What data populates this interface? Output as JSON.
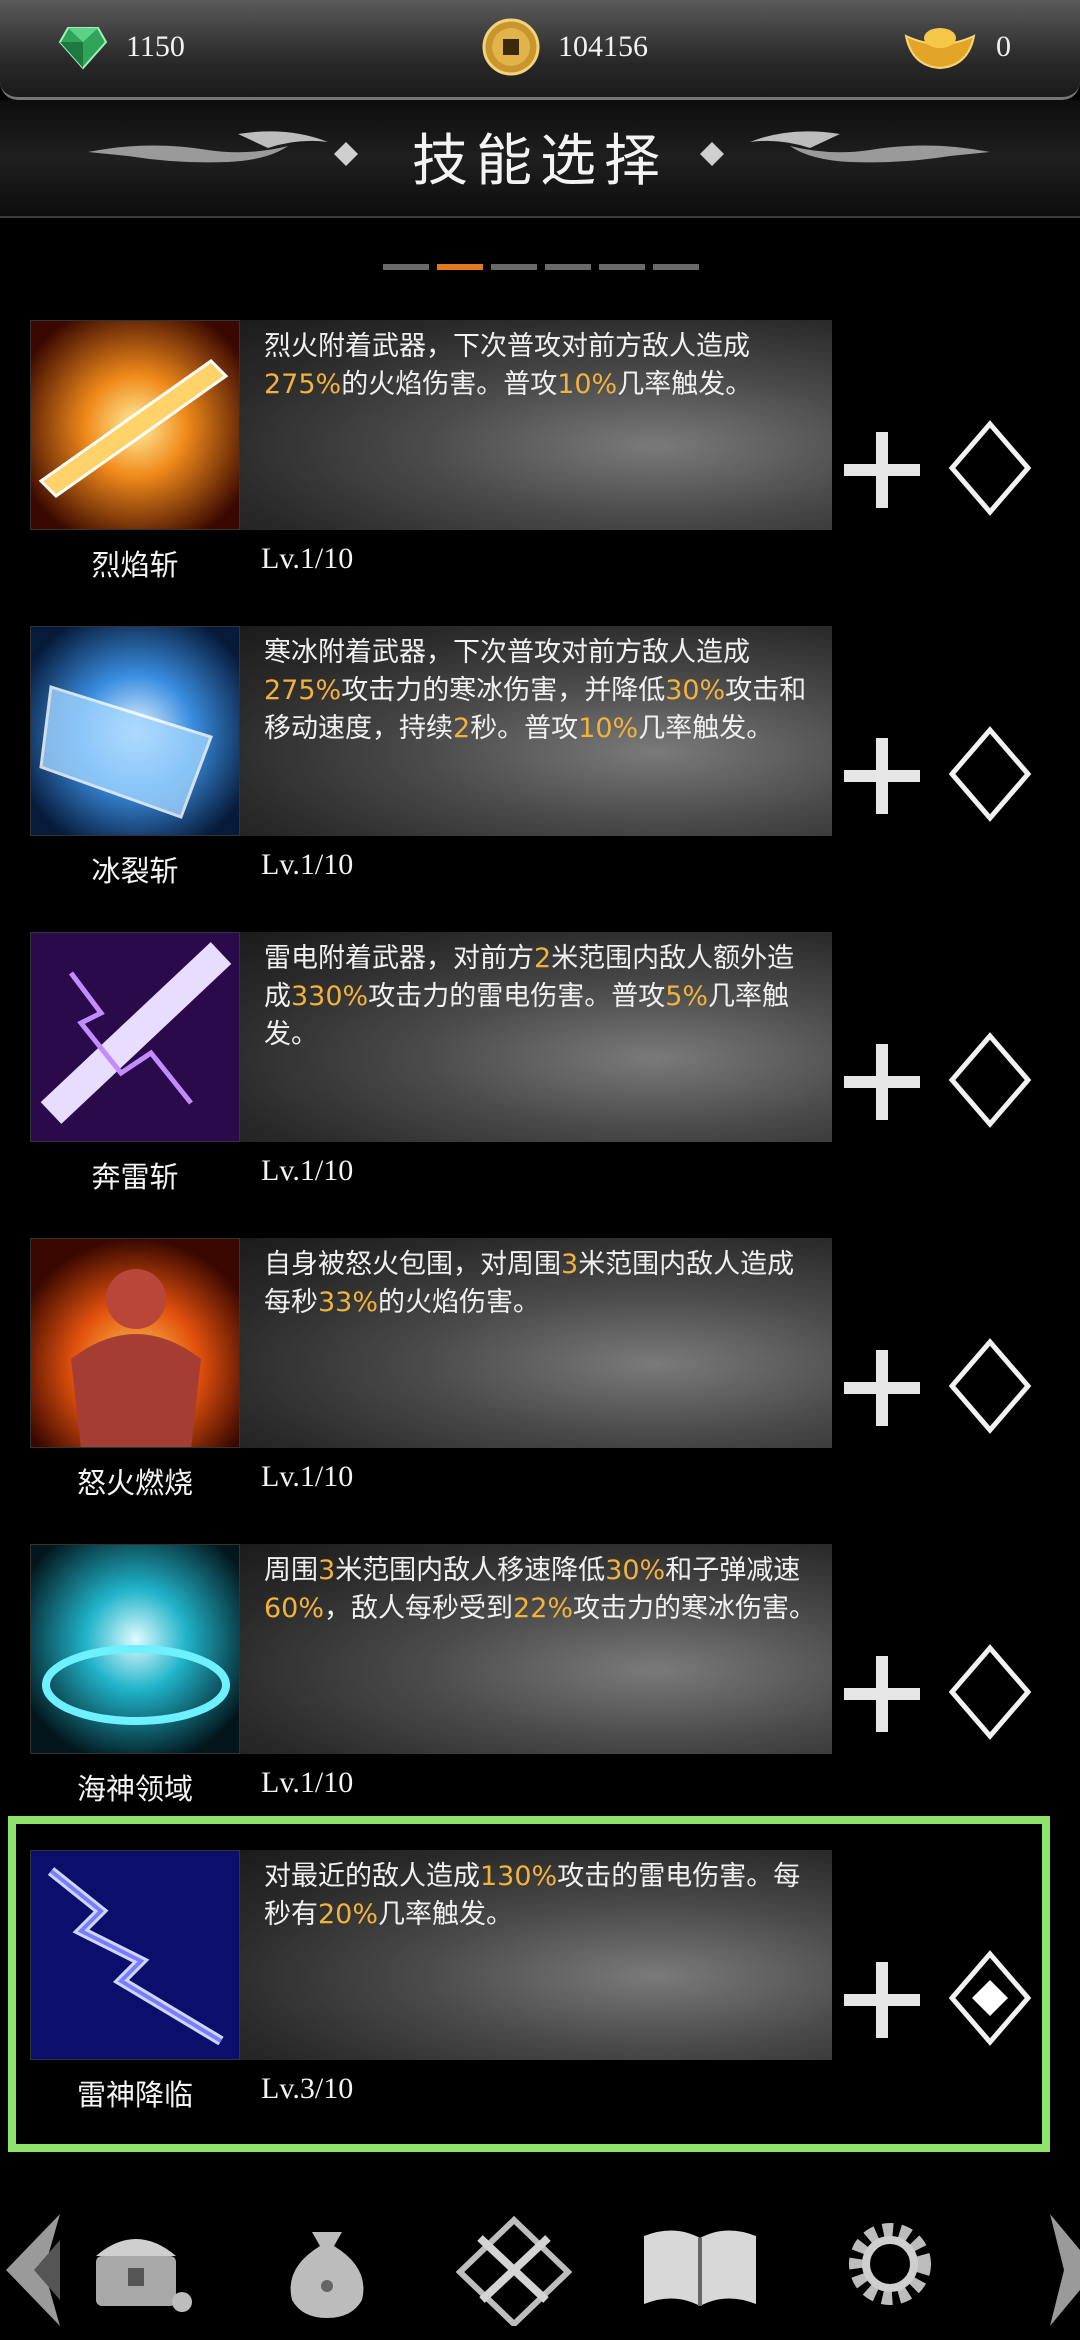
{
  "currencies": {
    "gems": "1150",
    "coins": "104156",
    "ingots": "0"
  },
  "title": "技能选择",
  "pager": {
    "count": 6,
    "active_index": 1
  },
  "colors": {
    "accent_highlight": "#8ee36a",
    "value_highlight": "#f2b23b",
    "pager_active": "#e07a1d"
  },
  "skills": [
    {
      "name": "烈焰斩",
      "level": "Lv.1/10",
      "icon": "fire-slash-icon",
      "desc": [
        [
          "烈火附着武器，下次普攻对前方敌人造",
          ""
        ],
        [
          "成",
          ""
        ],
        [
          "275%",
          "hl"
        ],
        [
          "的火焰伤害。普攻",
          ""
        ],
        [
          "10%",
          "hl"
        ],
        [
          "几率触发",
          ""
        ],
        [
          "。",
          ""
        ]
      ]
    },
    {
      "name": "冰裂斩",
      "level": "Lv.1/10",
      "icon": "ice-slash-icon",
      "desc": [
        [
          "寒冰附着武器，下次普攻对前方敌人造成",
          ""
        ],
        [
          "275%",
          "hl"
        ],
        [
          "攻击力的寒冰伤害，并降低",
          ""
        ],
        [
          "30%",
          "hl"
        ],
        [
          "攻击和移动速度，持续",
          ""
        ],
        [
          "2",
          "hl"
        ],
        [
          "秒。普攻",
          ""
        ],
        [
          "10%",
          "hl"
        ],
        [
          "几率触发。",
          ""
        ]
      ]
    },
    {
      "name": "奔雷斩",
      "level": "Lv.1/10",
      "icon": "thunder-slash-icon",
      "desc": [
        [
          "雷电附着武器，对前方",
          ""
        ],
        [
          "2",
          "hl"
        ],
        [
          "米范围内敌人额外造成",
          ""
        ],
        [
          "330%",
          "hl"
        ],
        [
          "攻击力的雷电伤害。普攻",
          ""
        ],
        [
          "5%",
          "hl"
        ],
        [
          "几率触发。",
          ""
        ]
      ]
    },
    {
      "name": "怒火燃烧",
      "level": "Lv.1/10",
      "icon": "rage-fire-icon",
      "desc": [
        [
          "自身被怒火包围，对周围",
          ""
        ],
        [
          "3",
          "hl"
        ],
        [
          "米范围内敌人造成每秒",
          ""
        ],
        [
          "33%",
          "hl"
        ],
        [
          "的火焰伤害。",
          ""
        ]
      ]
    },
    {
      "name": "海神领域",
      "level": "Lv.1/10",
      "icon": "sea-domain-icon",
      "desc": [
        [
          "周围",
          ""
        ],
        [
          "3",
          "hl"
        ],
        [
          "米范围内敌人移速降低",
          ""
        ],
        [
          "30%",
          "hl"
        ],
        [
          "和子弹减速",
          ""
        ],
        [
          "60%",
          "hl"
        ],
        [
          "，敌人每秒受到",
          ""
        ],
        [
          "22%",
          "hl"
        ],
        [
          "攻击力的寒冰伤害。",
          ""
        ]
      ]
    },
    {
      "name": "雷神降临",
      "level": "Lv.3/10",
      "icon": "thunder-god-icon",
      "selected": true,
      "desc": [
        [
          "对最近的敌人造成",
          ""
        ],
        [
          "130%",
          "hl"
        ],
        [
          "攻击的雷电伤害。每秒有",
          ""
        ],
        [
          "20%",
          "hl"
        ],
        [
          "几率触发。",
          ""
        ]
      ]
    }
  ],
  "nav": [
    "left-arrow-icon",
    "treasure-icon",
    "money-bag-icon",
    "crossed-swords-icon",
    "book-icon",
    "gear-icon",
    "right-arrow-icon"
  ]
}
